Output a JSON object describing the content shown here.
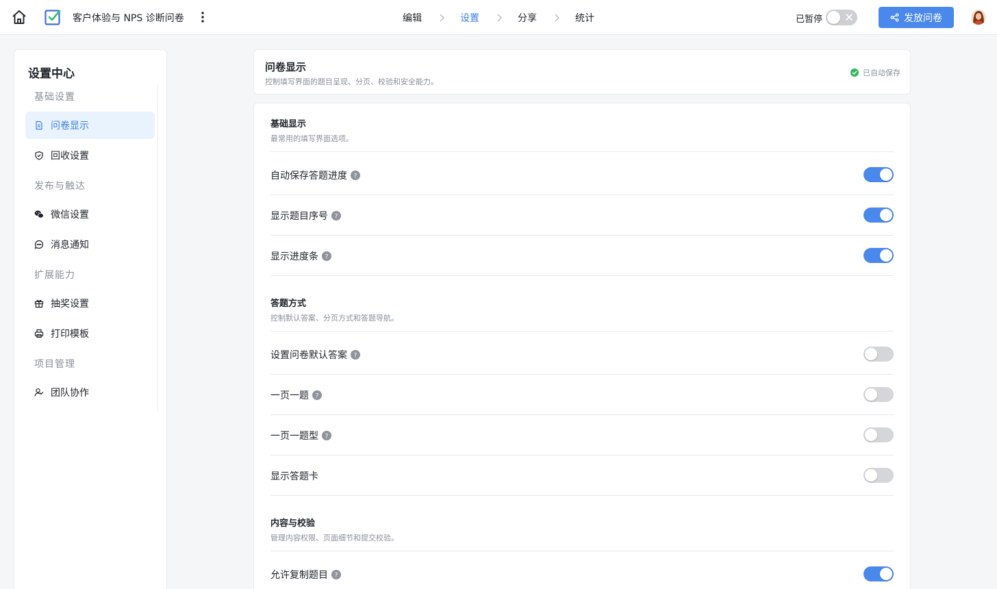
{
  "header": {
    "survey_title": "客户体验与 NPS 诊断问卷",
    "steps": [
      "编辑",
      "设置",
      "分享",
      "统计"
    ],
    "active_step": "设置",
    "pause_label": "已暂停",
    "pause_enabled": false,
    "publish_label": "发放问卷",
    "accent": "#4a88ec"
  },
  "sidebar": {
    "title": "设置中心",
    "groups": [
      {
        "label": "基础设置",
        "items": [
          {
            "label": "问卷显示",
            "icon": "document-icon",
            "active": true
          },
          {
            "label": "回收设置",
            "icon": "shield-check-icon",
            "active": false
          }
        ]
      },
      {
        "label": "发布与触达",
        "items": [
          {
            "label": "微信设置",
            "icon": "wechat-icon",
            "active": false
          },
          {
            "label": "消息通知",
            "icon": "chat-bubble-icon",
            "active": false
          }
        ]
      },
      {
        "label": "扩展能力",
        "items": [
          {
            "label": "抽奖设置",
            "icon": "gift-icon",
            "active": false
          },
          {
            "label": "打印模板",
            "icon": "printer-icon",
            "active": false
          }
        ]
      },
      {
        "label": "项目管理",
        "items": [
          {
            "label": "团队协作",
            "icon": "team-icon",
            "active": false
          }
        ]
      }
    ]
  },
  "panel": {
    "title": "问卷显示",
    "description": "控制填写界面的题目呈现、分页、校验和安全能力。",
    "saved_status": "已自动保存"
  },
  "sections": [
    {
      "title": "基础显示",
      "description": "最常用的填写界面选项。",
      "rows": [
        {
          "label": "自动保存答题进度",
          "help": true,
          "on": true
        },
        {
          "label": "显示题目序号",
          "help": true,
          "on": true
        },
        {
          "label": "显示进度条",
          "help": true,
          "on": true
        }
      ]
    },
    {
      "title": "答题方式",
      "description": "控制默认答案、分页方式和答题导航。",
      "rows": [
        {
          "label": "设置问卷默认答案",
          "help": true,
          "on": false
        },
        {
          "label": "一页一题",
          "help": true,
          "on": false
        },
        {
          "label": "一页一题型",
          "help": true,
          "on": false
        },
        {
          "label": "显示答题卡",
          "help": false,
          "on": false
        }
      ]
    },
    {
      "title": "内容与校验",
      "description": "管理内容权限、页面细节和提交校验。",
      "rows": [
        {
          "label": "允许复制题目",
          "help": true,
          "on": true
        }
      ]
    }
  ]
}
